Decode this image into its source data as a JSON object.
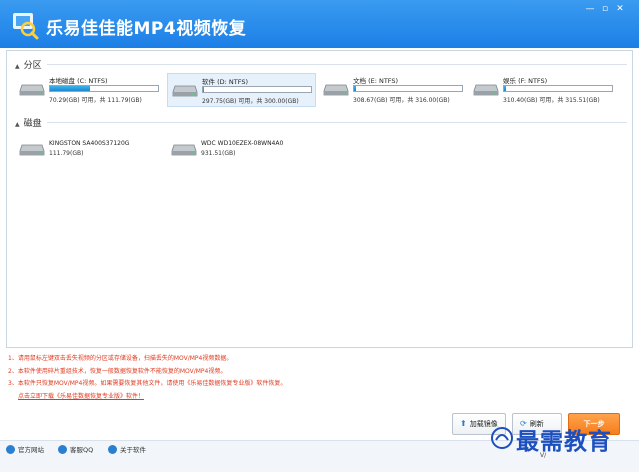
{
  "app": {
    "title": "乐易佳佳能MP4视频恢复"
  },
  "window_controls": {
    "minimize": "—",
    "maximize": "▫",
    "close": "✕"
  },
  "partitions_section": {
    "label": "分区",
    "items": [
      {
        "name": "本地磁盘 (C: NTFS)",
        "size": "70.29(GB) 可用，共 111.79(GB)",
        "used_fraction": 0.37,
        "selected": false
      },
      {
        "name": "软件 (D: NTFS)",
        "size": "297.75(GB) 可用，共 300.00(GB)",
        "used_fraction": 0.01,
        "selected": true
      },
      {
        "name": "文档 (E: NTFS)",
        "size": "308.67(GB) 可用，共 316.00(GB)",
        "used_fraction": 0.02,
        "selected": false
      },
      {
        "name": "娱乐 (F: NTFS)",
        "size": "310.40(GB) 可用，共 315.51(GB)",
        "used_fraction": 0.02,
        "selected": false
      }
    ]
  },
  "disks_section": {
    "label": "磁盘",
    "items": [
      {
        "name": "KINGSTON SA400S37120G",
        "size": "111.79(GB)"
      },
      {
        "name": "WDC WD10EZEX-08WN4A0",
        "size": "931.51(GB)"
      }
    ]
  },
  "notes": {
    "line1": "1、请用鼠标左键双击丢失视频的分区或存储设备，扫描丢失的MOV/MP4视频数据。",
    "line2": "2、本软件使用碎片重组技术，恢复一般数据恢复软件不能恢复的MOV/MP4视频。",
    "line3": "3、本软件只恢复MOV/MP4视频。如果需要恢复其他文件，请使用《乐易佳数据恢复专业版》软件恢复。",
    "download_link": "点击立即下载《乐易佳数据恢复专业版》软件！"
  },
  "buttons": {
    "load_image": "加载镜像",
    "refresh": "刷新",
    "next": "下一步"
  },
  "footer": {
    "website": "官方网站",
    "qq": "客服QQ",
    "about": "关于软件"
  },
  "watermark": {
    "text": "最需教育",
    "sub": "V/"
  },
  "colors": {
    "titlebar": "#1c7fe6",
    "accent": "#f57e1c",
    "note_text": "#e03a1e",
    "watermark": "#1d4fbf"
  }
}
